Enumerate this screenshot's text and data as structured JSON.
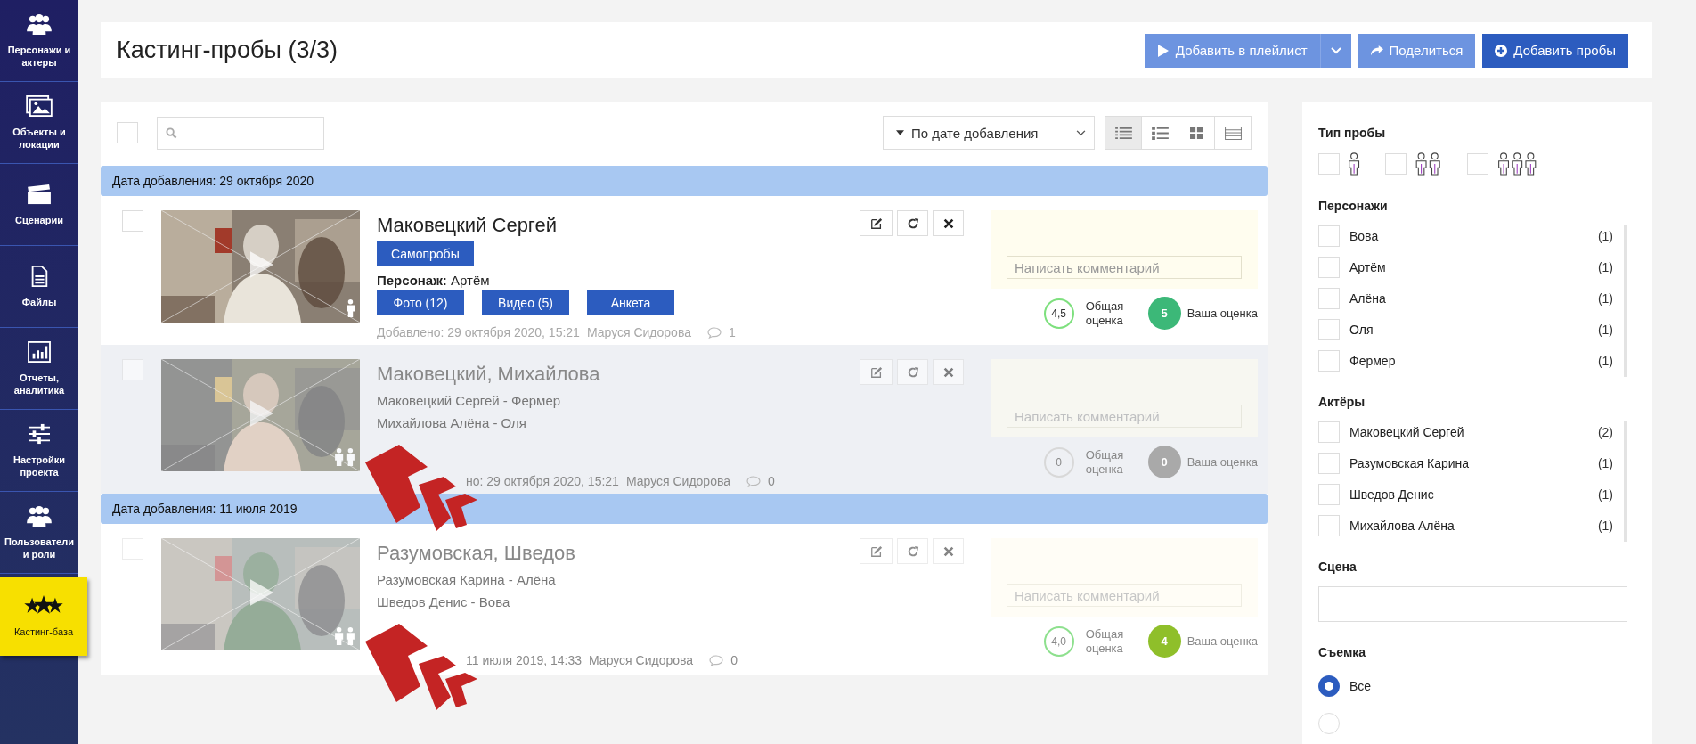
{
  "sidebar": {
    "items": [
      {
        "label": "Персонажи и актеры",
        "selected": false
      },
      {
        "label": "Объекты и локации",
        "selected": false
      },
      {
        "label": "Сценарии",
        "selected": false
      },
      {
        "label": "Файлы",
        "selected": false
      },
      {
        "label": "Отчеты, аналитика",
        "selected": false
      },
      {
        "label": "Настройки проекта",
        "selected": false
      },
      {
        "label": "Пользователи и роли",
        "selected": false
      },
      {
        "label": "Кастинг-база",
        "selected": true
      }
    ]
  },
  "header": {
    "title": "Кастинг-пробы (3/3)",
    "buttons": [
      {
        "label": "Добавить в плейлист",
        "kind": "playlist"
      },
      {
        "label": "Поделиться",
        "kind": "share"
      },
      {
        "label": "Добавить пробы",
        "kind": "add"
      }
    ]
  },
  "toolbar": {
    "select_all": {
      "checked": false
    },
    "sort": {
      "label": "По дате добавления"
    },
    "views": [
      {
        "selected": true
      },
      {
        "selected": false
      },
      {
        "selected": false
      },
      {
        "selected": false
      }
    ]
  },
  "groups": [
    {
      "title": "Дата добавления: 29 октября 2020",
      "rows": [
        {
          "kind": "self",
          "checked": false,
          "dimmed": false,
          "shaded": false,
          "annotated": false,
          "title": "Маковецкий Сергей",
          "tag": "Самопробы",
          "character": "**Персонаж:** Артём",
          "buttons": [
            "Фото (12)",
            "Видео (5)",
            "Анкета"
          ],
          "meta_date": "Добавлено: 29 октября 2020, 15:21",
          "meta_author": "Маруся Сидорова",
          "comments": "1",
          "comment_placeholder": "Написать комментарий",
          "total": {
            "text": "4,5",
            "color": "#7ee07e"
          },
          "total_label": "Общая оценка",
          "my_rating": {
            "text": "5",
            "color": "#3cb878"
          },
          "my_label": "Ваша оценка"
        },
        {
          "kind": "group",
          "checked": false,
          "dimmed": true,
          "shaded": true,
          "annotated": true,
          "title": "Маковецкий, Михайлова",
          "roles": [
            "Маковецкий Сергей - Фермер",
            "Михайлова Алёна - Оля"
          ],
          "meta_date": "но: 29 октября 2020, 15:21",
          "meta_author": "Маруся Сидорова",
          "comments": "0",
          "comment_placeholder": "Написать комментарий",
          "total": {
            "text": "0",
            "color": "#d8d8d8"
          },
          "total_label": "Общая оценка",
          "my_rating": {
            "text": "0",
            "color": "#a9a9a9"
          },
          "my_label": "Ваша оценка"
        }
      ]
    },
    {
      "title": "Дата добавления: 11 июля 2019",
      "rows": [
        {
          "kind": "group",
          "checked": false,
          "dimmed": true,
          "shaded": false,
          "annotated": true,
          "title": "Разумовская, Шведов",
          "roles": [
            "Разумовская Карина - Алёна",
            "Шведов Денис - Вова"
          ],
          "meta_date": "11 июля 2019, 14:33",
          "meta_author": "Маруся Сидорова",
          "comments": "0",
          "comment_placeholder": "Написать комментарий",
          "total": {
            "text": "4,0",
            "color": "#8ee08e"
          },
          "total_label": "Общая оценка",
          "my_rating": {
            "text": "4",
            "color": "#8fbf2a"
          },
          "my_label": "Ваша оценка"
        }
      ]
    }
  ],
  "filters": {
    "type": {
      "title": "Тип пробы",
      "options": [
        {
          "checked": false
        },
        {
          "checked": false
        },
        {
          "checked": false
        }
      ]
    },
    "characters": {
      "title": "Персонажи",
      "items": [
        {
          "label": "Вова",
          "count": "(1)",
          "checked": false
        },
        {
          "label": "Артём",
          "count": "(1)",
          "checked": false
        },
        {
          "label": "Алёна",
          "count": "(1)",
          "checked": false
        },
        {
          "label": "Оля",
          "count": "(1)",
          "checked": false
        },
        {
          "label": "Фермер",
          "count": "(1)",
          "checked": false
        }
      ]
    },
    "actors": {
      "title": "Актёры",
      "items": [
        {
          "label": "Маковецкий Сергей",
          "count": "(2)",
          "checked": false
        },
        {
          "label": "Разумовская Карина",
          "count": "(1)",
          "checked": false
        },
        {
          "label": "Шведов Денис",
          "count": "(1)",
          "checked": false
        },
        {
          "label": "Михайлова Алёна",
          "count": "(1)",
          "checked": false
        }
      ]
    },
    "scene": {
      "title": "Сцена"
    },
    "shooting": {
      "title": "Съемка",
      "options": [
        {
          "label": "Все",
          "selected": true
        },
        {
          "selected": false
        }
      ]
    }
  }
}
